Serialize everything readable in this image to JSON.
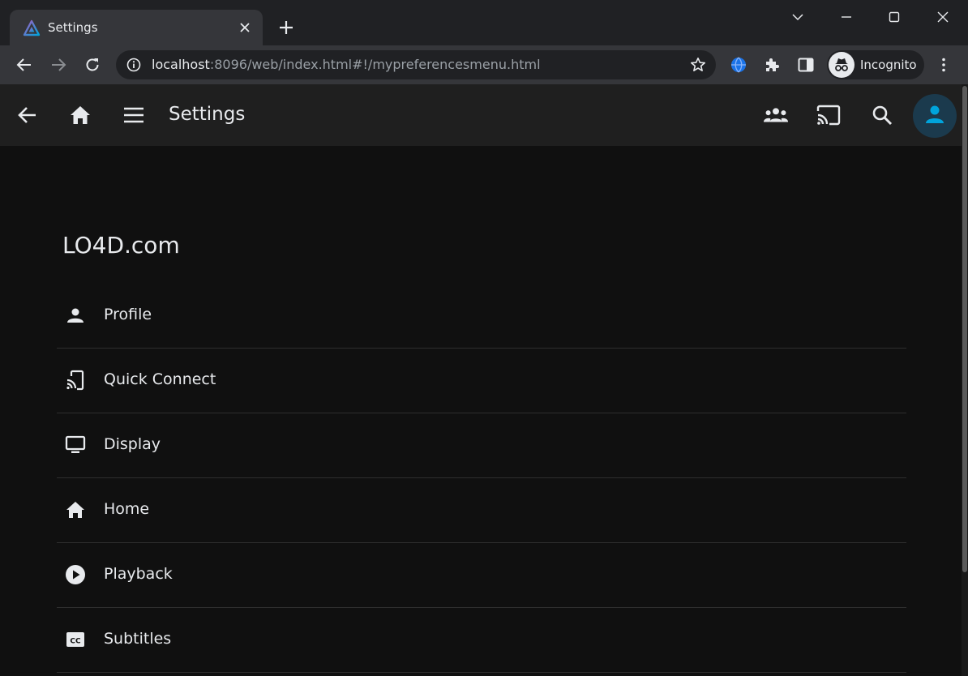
{
  "browser": {
    "tab_title": "Settings",
    "url_host": "localhost",
    "url_rest": ":8096/web/index.html#!/mypreferencesmenu.html",
    "profile_label": "Incognito"
  },
  "app": {
    "header_title": "Settings",
    "server_name": "LO4D.com",
    "accent_color": "#00a4dc"
  },
  "menu": {
    "items": [
      {
        "label": "Profile",
        "icon": "person-icon"
      },
      {
        "label": "Quick Connect",
        "icon": "cast-phone-icon"
      },
      {
        "label": "Display",
        "icon": "monitor-icon"
      },
      {
        "label": "Home",
        "icon": "home-icon"
      },
      {
        "label": "Playback",
        "icon": "play-circle-icon"
      },
      {
        "label": "Subtitles",
        "icon": "closed-captions-icon"
      }
    ]
  }
}
